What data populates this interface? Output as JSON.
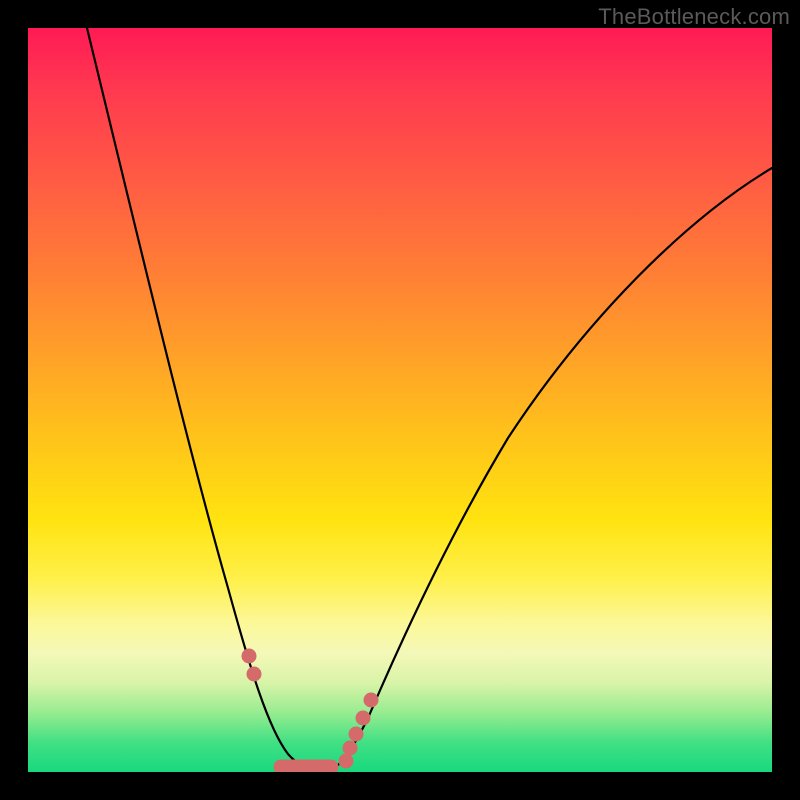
{
  "watermark": {
    "text": "TheBottleneck.com"
  },
  "chart_data": {
    "type": "line",
    "title": "",
    "xlabel": "",
    "ylabel": "",
    "xlim": [
      0,
      100
    ],
    "ylim": [
      0,
      100
    ],
    "background": {
      "gradient": "top-to-bottom",
      "stops": [
        {
          "pos": 0,
          "color": "#ff1a55",
          "meaning": "severe-bottleneck"
        },
        {
          "pos": 50,
          "color": "#ffc31a",
          "meaning": "moderate"
        },
        {
          "pos": 80,
          "color": "#fcf898",
          "meaning": "mild"
        },
        {
          "pos": 100,
          "color": "#18d87e",
          "meaning": "balanced"
        }
      ]
    },
    "series": [
      {
        "name": "bottleneck-curve",
        "color": "#000000",
        "x": [
          8,
          11,
          14,
          17,
          20,
          23,
          26,
          28,
          30,
          32,
          34,
          36,
          38,
          40,
          42,
          45,
          50,
          55,
          60,
          65,
          70,
          75,
          80,
          85,
          90,
          95,
          100
        ],
        "y": [
          100,
          88,
          76,
          64,
          53,
          42,
          32,
          24,
          17,
          11,
          6,
          3,
          1,
          1,
          2,
          6,
          15,
          24,
          32,
          39,
          46,
          52,
          58,
          63,
          68,
          72,
          75
        ]
      },
      {
        "name": "optimal-range-markers",
        "color": "#d46a6a",
        "type": "scatter",
        "x": [
          29.5,
          30,
          31,
          33,
          35,
          37,
          39,
          41,
          42.5,
          43.5,
          44.5
        ],
        "y": [
          16,
          13,
          10,
          5,
          2,
          1,
          1,
          2,
          4,
          7,
          10
        ]
      }
    ],
    "optimal_x_range": [
      34,
      40
    ],
    "optimal_y_value": 1
  }
}
